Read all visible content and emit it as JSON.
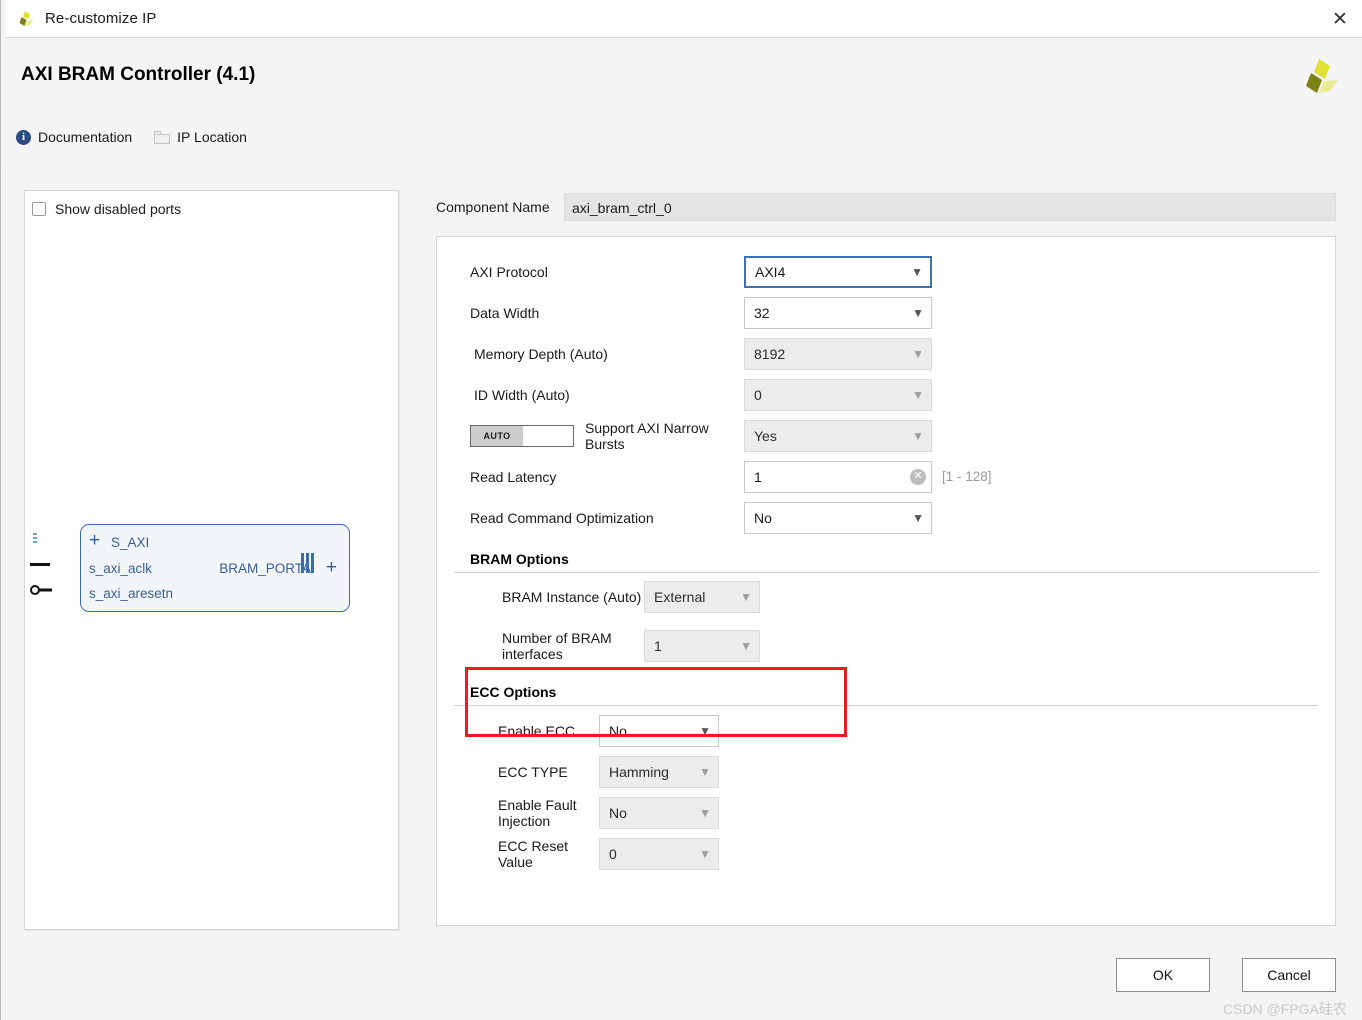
{
  "window": {
    "title": "Re-customize IP",
    "logo_icon": "xilinx-logo-icon",
    "close_icon": "close-icon"
  },
  "header": {
    "ip_title": "AXI BRAM Controller (4.1)",
    "logo_icon": "xilinx-logo-icon",
    "links": [
      {
        "label": "Documentation",
        "icon": "info-icon"
      },
      {
        "label": "IP Location",
        "icon": "folder-icon"
      }
    ]
  },
  "left_panel": {
    "show_disabled_ports": {
      "label": "Show disabled ports",
      "checked": false
    },
    "block": {
      "left_ports": [
        {
          "name": "S_AXI",
          "connector": "bus-stub",
          "expander": "+"
        },
        {
          "name": "s_axi_aclk",
          "connector": "clock-line"
        },
        {
          "name": "s_axi_aresetn",
          "connector": "reset-active-low"
        }
      ],
      "right_ports": [
        {
          "name": "BRAM_PORTA",
          "connector": "bus-bars",
          "expander": "+"
        }
      ]
    }
  },
  "component_name": {
    "label": "Component Name",
    "value": "axi_bram_ctrl_0"
  },
  "form": {
    "fields": [
      {
        "label": "AXI Protocol",
        "value": "AXI4",
        "type": "select",
        "state": "focused",
        "indent": "top"
      },
      {
        "label": "Data Width",
        "value": "32",
        "type": "select",
        "state": "enabled",
        "indent": "top"
      },
      {
        "label": "Memory Depth (Auto)",
        "value": "8192",
        "type": "select",
        "state": "disabled",
        "indent": "ind"
      },
      {
        "label": "ID Width (Auto)",
        "value": "0",
        "type": "select",
        "state": "disabled",
        "indent": "ind"
      }
    ],
    "narrow_bursts": {
      "toggle_label": "AUTO",
      "label": "Support AXI Narrow Bursts",
      "value": "Yes",
      "state": "disabled"
    },
    "read_latency": {
      "label": "Read Latency",
      "value": "1",
      "clear_icon": "clear-icon",
      "range_hint": "[1 - 128]"
    },
    "read_command_optimization": {
      "label": "Read Command Optimization",
      "value": "No",
      "state": "enabled"
    }
  },
  "bram_options": {
    "title": "BRAM Options",
    "fields": [
      {
        "label": "BRAM Instance (Auto)",
        "value": "External",
        "state": "disabled"
      },
      {
        "label": "Number of BRAM interfaces",
        "value": "1",
        "state": "disabled",
        "highlighted": true
      }
    ],
    "highlight_color": "#f01c1c"
  },
  "ecc_options": {
    "title": "ECC Options",
    "fields": [
      {
        "label": "Enable ECC",
        "value": "No",
        "state": "enabled"
      },
      {
        "label": "ECC TYPE",
        "value": "Hamming",
        "state": "disabled"
      },
      {
        "label": "Enable Fault Injection",
        "value": "No",
        "state": "disabled"
      },
      {
        "label": "ECC Reset Value",
        "value": "0",
        "state": "disabled"
      }
    ]
  },
  "footer": {
    "ok_label": "OK",
    "cancel_label": "Cancel",
    "watermark": "CSDN @FPGA硅农"
  }
}
